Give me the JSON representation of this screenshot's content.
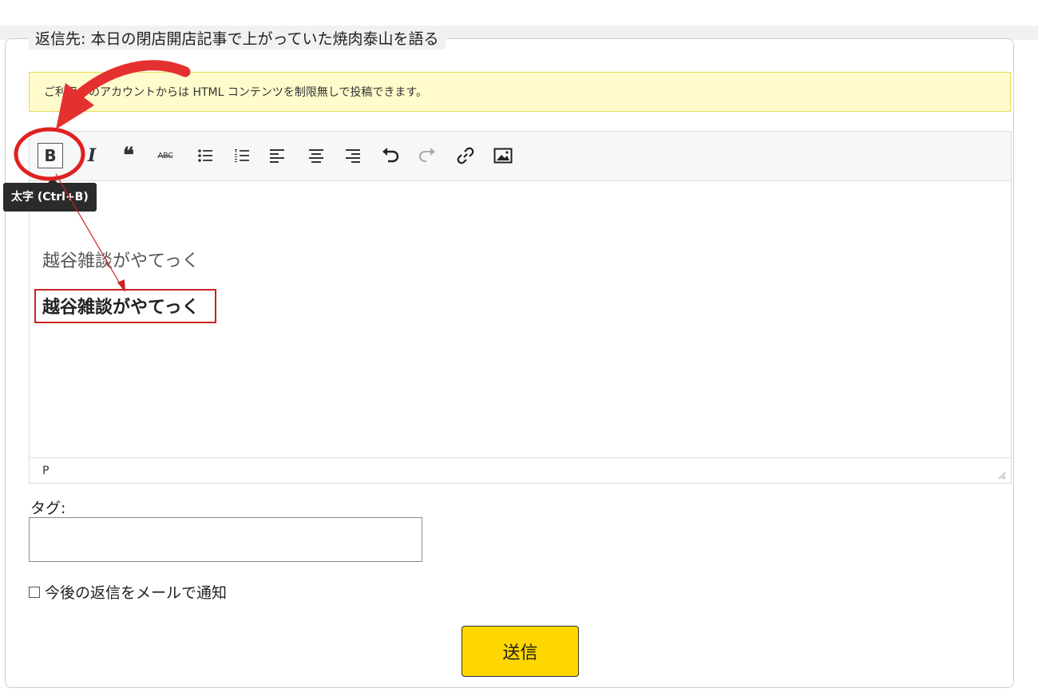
{
  "form": {
    "legend": "返信先: 本日の閉店開店記事で上がっていた焼肉泰山を語る",
    "notice": "ご利用中のアカウントからは HTML コンテンツを制限無しで投稿できます。"
  },
  "editor": {
    "toolbar": [
      {
        "name": "bold-button",
        "icon": "bold-icon",
        "label": "B",
        "active": true
      },
      {
        "name": "italic-button",
        "icon": "italic-icon",
        "label": "I"
      },
      {
        "name": "blockquote-button",
        "icon": "quote-icon",
        "label": "❝"
      },
      {
        "name": "strikethrough-button",
        "icon": "strikethrough-icon",
        "label": "ABC"
      },
      {
        "name": "bulleted-list-button",
        "icon": "bullet-list-icon"
      },
      {
        "name": "numbered-list-button",
        "icon": "numbered-list-icon"
      },
      {
        "name": "align-left-button",
        "icon": "align-left-icon"
      },
      {
        "name": "align-center-button",
        "icon": "align-center-icon"
      },
      {
        "name": "align-right-button",
        "icon": "align-right-icon"
      },
      {
        "name": "undo-button",
        "icon": "undo-icon"
      },
      {
        "name": "redo-button",
        "icon": "redo-icon"
      },
      {
        "name": "insert-link-button",
        "icon": "link-icon"
      },
      {
        "name": "insert-image-button",
        "icon": "image-icon"
      }
    ],
    "tooltip": "太字 (Ctrl+B)",
    "content_lines": [
      "越谷雑談がやてっく",
      "越谷雑談がやてっく"
    ],
    "status_path": "P"
  },
  "tags": {
    "label": "タグ:",
    "value": "",
    "placeholder": ""
  },
  "notify": {
    "label": "今後の返信をメールで通知",
    "checked": false
  },
  "submit": {
    "label": "送信"
  },
  "colors": {
    "accent_yellow": "#ffd700",
    "notice_bg": "#fffbcc",
    "annotation_red": "#e02020"
  }
}
